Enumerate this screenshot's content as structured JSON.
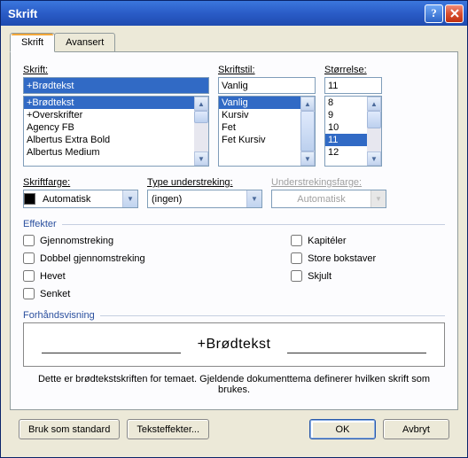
{
  "title": "Skrift",
  "tabs": {
    "font": "Skrift",
    "advanced": "Avansert"
  },
  "labels": {
    "font": "Skrift:",
    "style": "Skriftstil:",
    "size": "Størrelse:",
    "fontcolor": "Skriftfarge:",
    "underline": "Type understreking:",
    "underlinecolor": "Understrekingsfarge:"
  },
  "font": {
    "value": "+Brødtekst",
    "items": [
      "+Brødtekst",
      "+Overskrifter",
      "Agency FB",
      "Albertus Extra Bold",
      "Albertus Medium"
    ],
    "selectedIndex": 0
  },
  "style": {
    "value": "Vanlig",
    "items": [
      "Vanlig",
      "Kursiv",
      "Fet",
      "Fet Kursiv"
    ],
    "selectedIndex": 0
  },
  "size": {
    "value": "11",
    "items": [
      "8",
      "9",
      "10",
      "11",
      "12"
    ],
    "selectedIndex": 3
  },
  "fontcolor": "Automatisk",
  "underline_type": "(ingen)",
  "underline_color": "Automatisk",
  "groups": {
    "effects": "Effekter",
    "preview": "Forhåndsvisning"
  },
  "effects": {
    "strike": "Gjennomstreking",
    "dstrike": "Dobbel gjennomstreking",
    "super": "Hevet",
    "sub": "Senket",
    "smallcaps": "Kapitéler",
    "allcaps": "Store bokstaver",
    "hidden": "Skjult"
  },
  "preview_text": "+Brødtekst",
  "description": "Dette er brødtekstskriften for temaet. Gjeldende dokumenttema definerer hvilken skrift som brukes.",
  "buttons": {
    "default": "Bruk som standard",
    "texteffects": "Teksteffekter...",
    "ok": "OK",
    "cancel": "Avbryt"
  }
}
